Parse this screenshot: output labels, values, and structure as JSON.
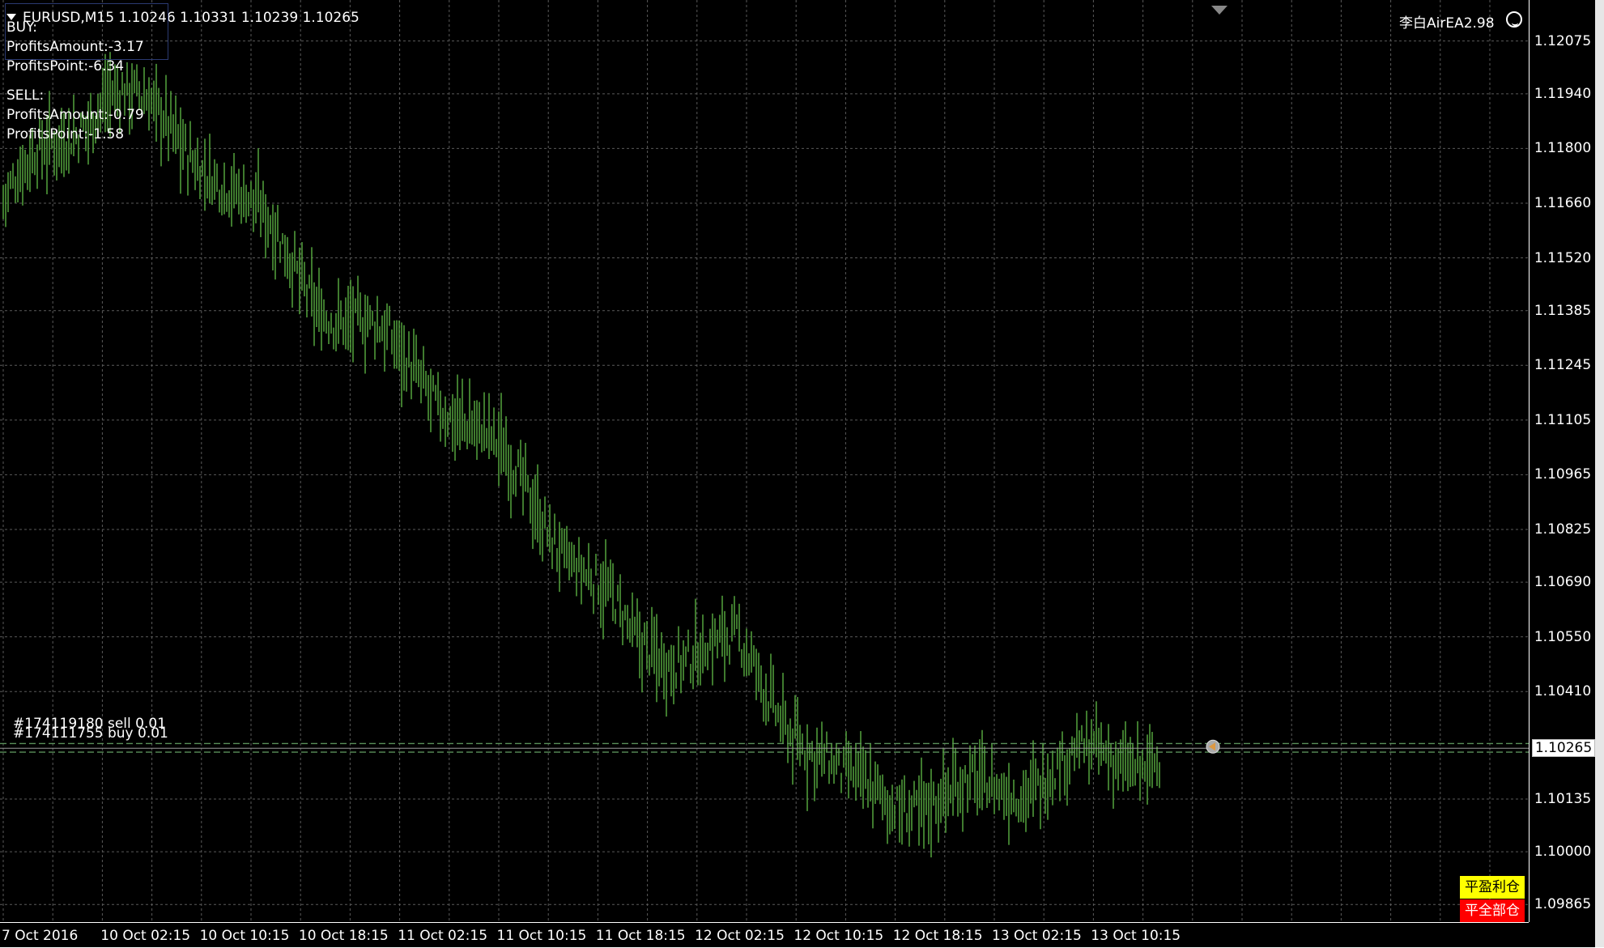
{
  "window": {
    "symbol_header": "EURUSD,M15  1.10246 1.10331 1.10239 1.10265",
    "ea_name": "李白AirEA2.98"
  },
  "info_panel": {
    "buy_label": "BUY:",
    "buy_profit_amount": "ProfitsAmount:-3.17",
    "buy_profit_point": "ProfitsPoint:-6.34",
    "sell_label": "SELL:",
    "sell_profit_amount": "ProfitsAmount:-0.79",
    "sell_profit_point": "ProfitsPoint:-1.58"
  },
  "orders": {
    "sell_order": "#174119180 sell 0.01",
    "buy_order": "#174111755 buy 0.01"
  },
  "buttons": {
    "close_profit": "平盈利仓",
    "close_all": "平全部仓"
  },
  "icons": {
    "dropdown": "triangle-down-icon",
    "smiley": "smiley-face-icon",
    "shift": "chart-shift-marker-icon"
  },
  "colors": {
    "background": "#000000",
    "bars": "#4f9a3a",
    "grid": "#5a5a5a",
    "text": "#ffffff",
    "order_line": "#5a8f5a",
    "close_profit_button": "#ffff00",
    "close_all_button": "#ff0000"
  },
  "chart_data": {
    "type": "line",
    "title": "EURUSD,M15",
    "ohlc_last": {
      "open": 1.10246,
      "high": 1.10331,
      "low": 1.10239,
      "close": 1.10265
    },
    "current_price": "1.10265",
    "y_ticks": [
      "1.12075",
      "1.11940",
      "1.11800",
      "1.11660",
      "1.11520",
      "1.11385",
      "1.11245",
      "1.11105",
      "1.10965",
      "1.10825",
      "1.10690",
      "1.10550",
      "1.10410",
      "1.10135",
      "1.10000",
      "1.09865"
    ],
    "ylim": [
      1.0982,
      1.1218
    ],
    "x_ticks": [
      "7 Oct 2016",
      "10 Oct 02:15",
      "10 Oct 10:15",
      "10 Oct 18:15",
      "11 Oct 02:15",
      "11 Oct 10:15",
      "11 Oct 18:15",
      "12 Oct 02:15",
      "12 Oct 10:15",
      "12 Oct 18:15",
      "13 Oct 02:15",
      "13 Oct 10:15"
    ],
    "series": [
      {
        "name": "",
        "x": [
          "7 Oct 2016",
          "10 Oct 02:15",
          "10 Oct 10:15",
          "10 Oct 18:15",
          "11 Oct 02:15",
          "11 Oct 10:15",
          "11 Oct 18:15",
          "12 Oct 02:15",
          "12 Oct 10:15",
          "12 Oct 18:15",
          "13 Oct 02:15",
          "13 Oct 10:15"
        ],
        "values": [
          1.1166,
          1.1196,
          1.1176,
          1.1142,
          1.1122,
          1.1092,
          1.1053,
          1.1051,
          1.1016,
          1.1013,
          1.1021,
          1.1026
        ]
      }
    ],
    "orders": [
      {
        "label": "#174119180 sell 0.01",
        "price": 1.10277
      },
      {
        "label": "#174111755 buy 0.01",
        "price": 1.10255
      }
    ],
    "grid": true
  }
}
